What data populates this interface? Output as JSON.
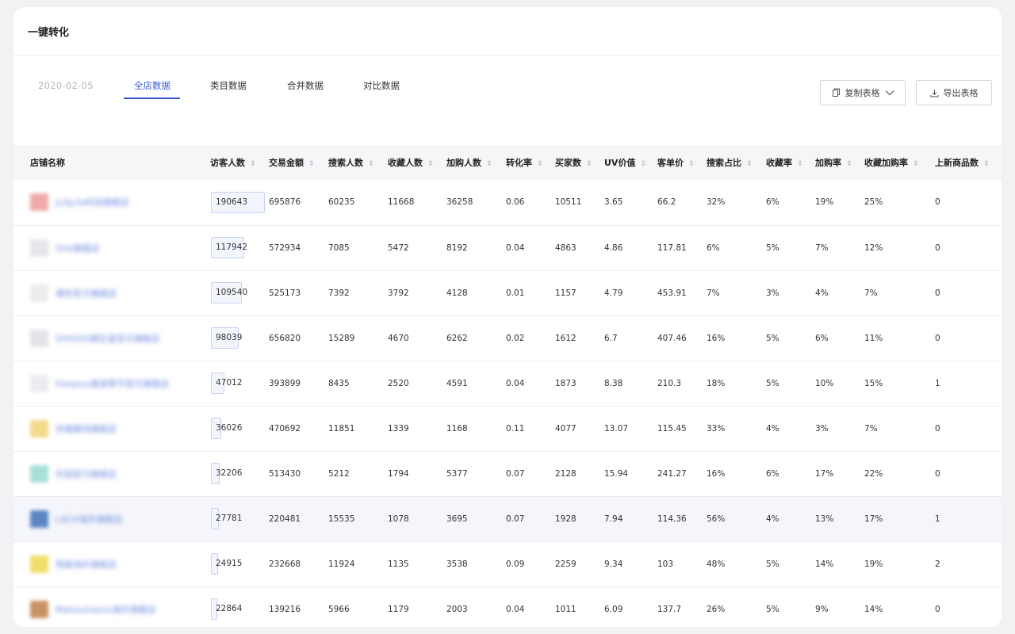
{
  "title": "一键转化",
  "date": "2020-02-05",
  "tabs": [
    {
      "label": "全店数据",
      "active": true
    },
    {
      "label": "类目数据",
      "active": false
    },
    {
      "label": "合并数据",
      "active": false
    },
    {
      "label": "对比数据",
      "active": false
    }
  ],
  "buttons": {
    "copy": "复制表格",
    "export": "导出表格"
  },
  "colors": {
    "accent": "#3d5bd9",
    "highlight_row": "#f4f6fb",
    "link": "#6c86df"
  },
  "table": {
    "columns": [
      "店铺名称",
      "访客人数",
      "交易金额",
      "搜索人数",
      "收藏人数",
      "加购人数",
      "转化率",
      "买家数",
      "UV价值",
      "客单价",
      "搜索占比",
      "收藏率",
      "加购率",
      "收藏加购率",
      "上新商品数"
    ],
    "sortable": [
      false,
      true,
      true,
      true,
      true,
      true,
      true,
      true,
      true,
      true,
      true,
      true,
      true,
      true,
      true
    ],
    "visitor_max": 190643,
    "highlighted_row": 7,
    "rows": [
      {
        "logo_color": "#f2a9a9",
        "shop": "JuSp3a时尚旗舰店",
        "cells": [
          "190643",
          "695876",
          "60235",
          "11668",
          "36258",
          "0.06",
          "10511",
          "3.65",
          "66.2",
          "32%",
          "6%",
          "19%",
          "25%",
          "0"
        ]
      },
      {
        "logo_color": "#e6e6ea",
        "shop": "Orei旗舰店",
        "cells": [
          "117942",
          "572934",
          "7085",
          "5472",
          "8192",
          "0.04",
          "4863",
          "4.86",
          "117.81",
          "6%",
          "5%",
          "7%",
          "12%",
          "0"
        ]
      },
      {
        "logo_color": "#ececef",
        "shop": "潮衣官方旗舰店",
        "cells": [
          "109540",
          "525173",
          "7392",
          "3792",
          "4128",
          "0.01",
          "1157",
          "4.79",
          "453.91",
          "7%",
          "3%",
          "4%",
          "7%",
          "0"
        ]
      },
      {
        "logo_color": "#e4e4e8",
        "shop": "SHIGOU朗生皇官方旗舰店",
        "cells": [
          "98039",
          "656820",
          "15289",
          "4670",
          "6262",
          "0.02",
          "1612",
          "6.7",
          "407.46",
          "16%",
          "5%",
          "6%",
          "11%",
          "0"
        ]
      },
      {
        "logo_color": "#ececf0",
        "shop": "freeplus美丽季节官方旗舰店",
        "cells": [
          "47012",
          "393899",
          "8435",
          "2520",
          "4591",
          "0.04",
          "1873",
          "8.38",
          "210.3",
          "18%",
          "5%",
          "10%",
          "15%",
          "1"
        ]
      },
      {
        "logo_color": "#f3d98a",
        "shop": "衣格服饰旗舰店",
        "cells": [
          "36026",
          "470692",
          "11851",
          "1339",
          "1168",
          "0.11",
          "4077",
          "13.07",
          "115.45",
          "33%",
          "4%",
          "3%",
          "7%",
          "0"
        ]
      },
      {
        "logo_color": "#a8e0d8",
        "shop": "乐园官方旗舰店",
        "cells": [
          "32206",
          "513430",
          "5212",
          "1794",
          "5377",
          "0.07",
          "2128",
          "15.94",
          "241.27",
          "16%",
          "6%",
          "17%",
          "22%",
          "0"
        ]
      },
      {
        "logo_color": "#5b86c5",
        "shop": "LACH海外旗舰店",
        "cells": [
          "27781",
          "220481",
          "15535",
          "1078",
          "3695",
          "0.07",
          "1928",
          "7.94",
          "114.36",
          "56%",
          "4%",
          "13%",
          "17%",
          "1"
        ]
      },
      {
        "logo_color": "#f0de6a",
        "shop": "雨森海外旗舰店",
        "cells": [
          "24915",
          "232668",
          "11924",
          "1135",
          "3538",
          "0.09",
          "2259",
          "9.34",
          "103",
          "48%",
          "5%",
          "14%",
          "19%",
          "2"
        ]
      },
      {
        "logo_color": "#c99262",
        "shop": "Mahoutokoro海外旗舰店",
        "cells": [
          "22864",
          "139216",
          "5966",
          "1179",
          "2003",
          "0.04",
          "1011",
          "6.09",
          "137.7",
          "26%",
          "5%",
          "9%",
          "14%",
          "0"
        ]
      }
    ]
  }
}
